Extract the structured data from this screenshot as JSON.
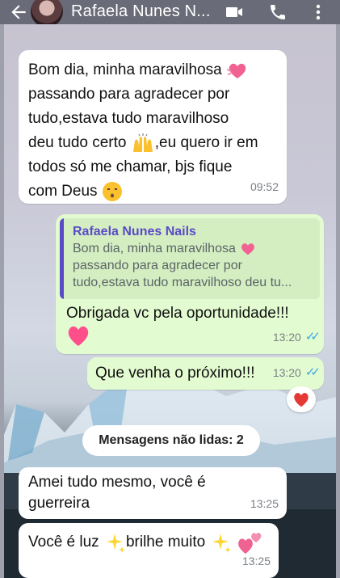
{
  "header": {
    "contact_name": "Rafaela Nunes N...",
    "icons": [
      "back-arrow-icon",
      "video-call-icon",
      "phone-icon",
      "more-vert-icon"
    ]
  },
  "messages": [
    {
      "direction": "incoming",
      "lines": [
        "Bom dia, minha maravilhosa",
        "passando para agradecer por",
        "tudo,estava tudo maravilhoso",
        "deu tudo certo",
        ",eu quero ir em",
        "todos só me chamar, bjs fique",
        "com Deus"
      ],
      "time": "09:52"
    },
    {
      "direction": "outgoing",
      "reply_to": {
        "author": "Rafaela Nunes Nails",
        "lines": [
          "Bom dia, minha maravilhosa",
          "passando para agradecer por",
          "tudo,estava tudo maravilhoso deu tu..."
        ]
      },
      "text": "Obrigada vc pela oportunidade!!!",
      "time": "13:20",
      "status": "read"
    },
    {
      "direction": "outgoing",
      "text": "Que venha o próximo!!!",
      "time": "13:20",
      "status": "read",
      "reaction": "red-heart"
    },
    {
      "direction": "incoming",
      "lines": [
        "Amei tudo mesmo, você é",
        "guerreira"
      ],
      "time": "13:25"
    },
    {
      "direction": "incoming",
      "lines": [
        "Você é luz",
        "brilhe muito"
      ],
      "time": "13:25"
    }
  ],
  "unread_banner": "Mensagens não lidas: 2",
  "colors": {
    "header": "#6a6b78",
    "incoming_bubble": "#ffffff",
    "outgoing_bubble": "#e3fbd0",
    "read_ticks": "#3ba7e6",
    "quote_author": "#5a4ac8"
  }
}
